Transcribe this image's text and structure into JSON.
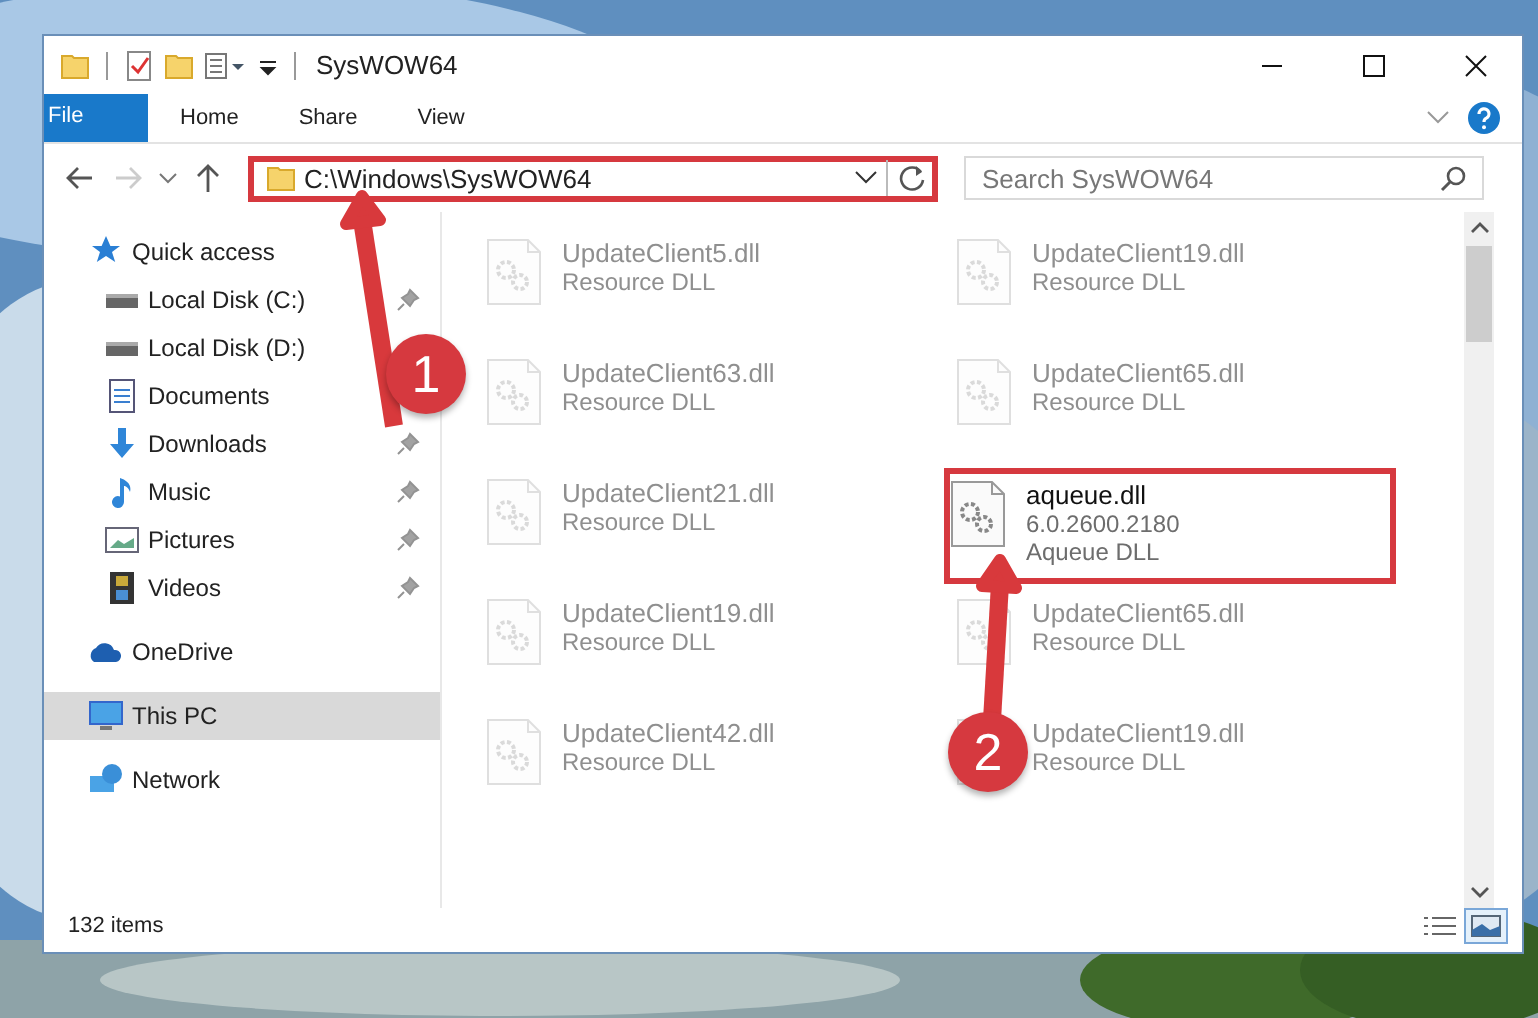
{
  "window": {
    "title": "SysWOW64"
  },
  "ribbon_tabs": [
    {
      "label": "File",
      "kind": "file"
    },
    {
      "label": "Home",
      "kind": "tab"
    },
    {
      "label": "Share",
      "kind": "tab"
    },
    {
      "label": "View",
      "kind": "tab"
    }
  ],
  "address_bar": {
    "path": "C:\\Windows\\SysWOW64",
    "highlighted": true
  },
  "search": {
    "placeholder": "Search SysWOW64"
  },
  "sidebar": {
    "items": [
      {
        "label": "Quick access",
        "kind": "star",
        "selected": false,
        "children": [
          {
            "label": "Local Disk (C:)",
            "kind": "disk",
            "pinned": true
          },
          {
            "label": "Local Disk (D:)",
            "kind": "disk",
            "pinned": false
          },
          {
            "label": "Documents",
            "kind": "document",
            "pinned": false
          },
          {
            "label": "Downloads",
            "kind": "download",
            "pinned": true
          },
          {
            "label": "Music",
            "kind": "music",
            "pinned": true
          },
          {
            "label": "Pictures",
            "kind": "pictures",
            "pinned": true
          },
          {
            "label": "Videos",
            "kind": "videos",
            "pinned": true
          }
        ]
      },
      {
        "label": "OneDrive",
        "kind": "cloud",
        "selected": false
      },
      {
        "label": "This PC",
        "kind": "computer",
        "selected": true
      },
      {
        "label": "Network",
        "kind": "network",
        "selected": false
      }
    ]
  },
  "files": [
    {
      "name": "UpdateClient5.dll",
      "description": "Resource DLL",
      "faded": true,
      "highlighted": false
    },
    {
      "name": "UpdateClient19.dll",
      "description": "Resource DLL",
      "faded": true,
      "highlighted": false
    },
    {
      "name": "UpdateClient63.dll",
      "description": "Resource DLL",
      "faded": true,
      "highlighted": false
    },
    {
      "name": "UpdateClient65.dll",
      "description": "Resource DLL",
      "faded": true,
      "highlighted": false
    },
    {
      "name": "UpdateClient21.dll",
      "description": "Resource DLL",
      "faded": true,
      "highlighted": false
    },
    {
      "name": "aqueue.dll",
      "version": "6.0.2600.2180",
      "description": "Aqueue DLL",
      "faded": false,
      "highlighted": true
    },
    {
      "name": "UpdateClient19.dll",
      "description": "Resource DLL",
      "faded": true,
      "highlighted": false
    },
    {
      "name": "UpdateClient65.dll",
      "description": "Resource DLL",
      "faded": true,
      "highlighted": false
    },
    {
      "name": "UpdateClient42.dll",
      "description": "Resource DLL",
      "faded": true,
      "highlighted": false
    },
    {
      "name": "UpdateClient19.dll",
      "description": "Resource DLL",
      "faded": true,
      "highlighted": false
    }
  ],
  "status_bar": {
    "item_count": "132 items",
    "view_buttons": [
      {
        "kind": "details",
        "selected": false
      },
      {
        "kind": "tiles",
        "selected": true
      }
    ]
  },
  "annotations": [
    {
      "label": "1"
    },
    {
      "label": "2"
    }
  ]
}
